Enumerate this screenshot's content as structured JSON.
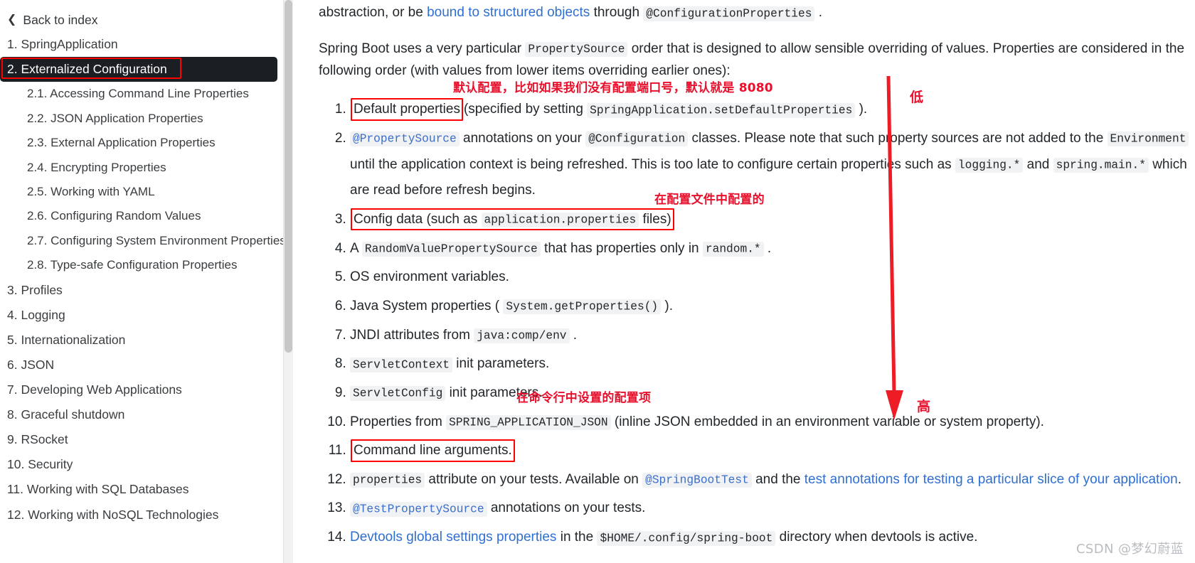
{
  "sidebar": {
    "back_label": "Back to index",
    "back_icon": "chevron-left-icon",
    "items": [
      {
        "label": "1. SpringApplication",
        "level": 1,
        "active": false
      },
      {
        "label": "2. Externalized Configuration",
        "level": 1,
        "active": true
      },
      {
        "label": "2.1. Accessing Command Line Properties",
        "level": 2,
        "active": false
      },
      {
        "label": "2.2. JSON Application Properties",
        "level": 2,
        "active": false
      },
      {
        "label": "2.3. External Application Properties",
        "level": 2,
        "active": false
      },
      {
        "label": "2.4. Encrypting Properties",
        "level": 2,
        "active": false
      },
      {
        "label": "2.5. Working with YAML",
        "level": 2,
        "active": false
      },
      {
        "label": "2.6. Configuring Random Values",
        "level": 2,
        "active": false
      },
      {
        "label": "2.7. Configuring System Environment Properties",
        "level": 2,
        "active": false
      },
      {
        "label": "2.8. Type-safe Configuration Properties",
        "level": 2,
        "active": false
      },
      {
        "label": "3. Profiles",
        "level": 1,
        "active": false
      },
      {
        "label": "4. Logging",
        "level": 1,
        "active": false
      },
      {
        "label": "5. Internationalization",
        "level": 1,
        "active": false
      },
      {
        "label": "6. JSON",
        "level": 1,
        "active": false
      },
      {
        "label": "7. Developing Web Applications",
        "level": 1,
        "active": false
      },
      {
        "label": "8. Graceful shutdown",
        "level": 1,
        "active": false
      },
      {
        "label": "9. RSocket",
        "level": 1,
        "active": false
      },
      {
        "label": "10. Security",
        "level": 1,
        "active": false
      },
      {
        "label": "11. Working with SQL Databases",
        "level": 1,
        "active": false
      },
      {
        "label": "12. Working with NoSQL Technologies",
        "level": 1,
        "active": false
      }
    ]
  },
  "main": {
    "para_top": {
      "t1": "abstraction, or be ",
      "link": "bound to structured objects",
      "t2": " through ",
      "code": "@ConfigurationProperties",
      "t3": " ."
    },
    "para_intro": {
      "t1": "Spring Boot uses a very particular ",
      "code": "PropertySource",
      "t2": " order that is designed to allow sensible overriding of values. Properties are considered in the following order (with values from lower items overriding earlier ones):"
    },
    "list": {
      "i1": {
        "boxed": "Default properties",
        "t2": "(specified by setting ",
        "code": "SpringApplication.setDefaultProperties",
        "t3": " )."
      },
      "i2": {
        "c1": "@PropertySource",
        "t1": " annotations on your ",
        "c2": "@Configuration",
        "t2": " classes. Please note that such property sources are not added to the ",
        "c3": "Environment",
        "t3": " until the application context is being refreshed. This is too late to configure certain properties such as ",
        "c4": "logging.*",
        "t4": " and ",
        "c5": "spring.main.*",
        "t5": " which are read before refresh begins."
      },
      "i3": {
        "b1": "Config data (such as ",
        "bcode": "application.properties",
        "b2": " files)"
      },
      "i4": {
        "t1": "A ",
        "code": "RandomValuePropertySource",
        "t2": " that has properties only in ",
        "code2": "random.*",
        "t3": " ."
      },
      "i5": {
        "t1": "OS environment variables."
      },
      "i6": {
        "t1": "Java System properties ( ",
        "code": "System.getProperties()",
        "t2": " )."
      },
      "i7": {
        "t1": "JNDI attributes from ",
        "code": "java:comp/env",
        "t2": " ."
      },
      "i8": {
        "code": "ServletContext",
        "t1": " init parameters."
      },
      "i9": {
        "code": "ServletConfig",
        "t1": " init parameters."
      },
      "i10": {
        "t1": "Properties from ",
        "code": "SPRING_APPLICATION_JSON",
        "t2": " (inline JSON embedded in an environment variable or system property)."
      },
      "i11": {
        "boxed": "Command line arguments."
      },
      "i12": {
        "code": "properties",
        "t1": " attribute on your tests. Available on ",
        "code2": "@SpringBootTest",
        "t2": " and the ",
        "link": "test annotations for testing a particular slice of your application",
        "t3": "."
      },
      "i13": {
        "code": "@TestPropertySource",
        "t1": " annotations on your tests."
      },
      "i14": {
        "link": "Devtools global settings properties",
        "t1": " in the ",
        "code": "$HOME/.config/spring-boot",
        "t2": " directory when devtools is active."
      }
    },
    "annotations": {
      "note_default": "默认配置，比如如果我们没有配置端口号，默认就是 8080",
      "note_configfile": "在配置文件中配置的",
      "note_cmdline": "在命令行中设置的配置项",
      "arrow_low": "低",
      "arrow_high": "高",
      "arrow_color": "#ee1c25",
      "box_color": "#ff0000",
      "note_color": "#e8112d"
    },
    "watermark": "CSDN @梦幻蔚蓝"
  }
}
